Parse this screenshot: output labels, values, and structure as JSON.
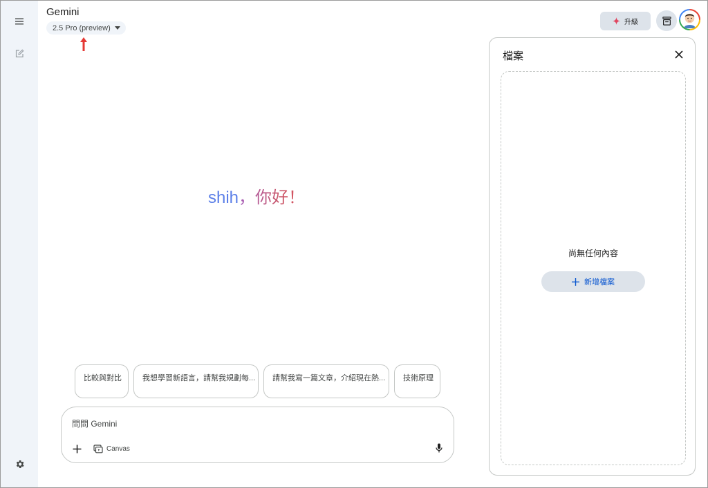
{
  "header": {
    "app_title": "Gemini",
    "model_label": "2.5 Pro (preview)",
    "upgrade_label": "升級"
  },
  "greeting": {
    "name": "shih",
    "rest": "，你好！"
  },
  "suggestions": [
    {
      "label": "比較與對比"
    },
    {
      "label": "我想學習新語言，請幫我規劃每..."
    },
    {
      "label": "請幫我寫一篇文章，介紹現在熱..."
    },
    {
      "label": "技術原理"
    }
  ],
  "composer": {
    "placeholder": "問問 Gemini",
    "canvas_label": "Canvas"
  },
  "files_panel": {
    "title": "檔案",
    "empty_text": "尚無任何內容",
    "add_label": "新增檔案"
  },
  "icons": {
    "menu": "menu-icon",
    "new_chat": "edit-icon",
    "settings": "gear-icon",
    "dropdown": "caret-down-icon",
    "sparkle": "sparkle-icon",
    "gift": "gift-icon",
    "close": "close-icon",
    "plus": "plus-icon",
    "canvas": "canvas-icon",
    "mic": "mic-icon"
  },
  "colors": {
    "sidebar_bg": "#f0f4f9",
    "accent_blue": "#0b57d0",
    "sparkle": "#e0455f",
    "arrow": "#e53935",
    "greeting_name": "#5b7fe8",
    "greeting_rest": "#c9586c"
  }
}
